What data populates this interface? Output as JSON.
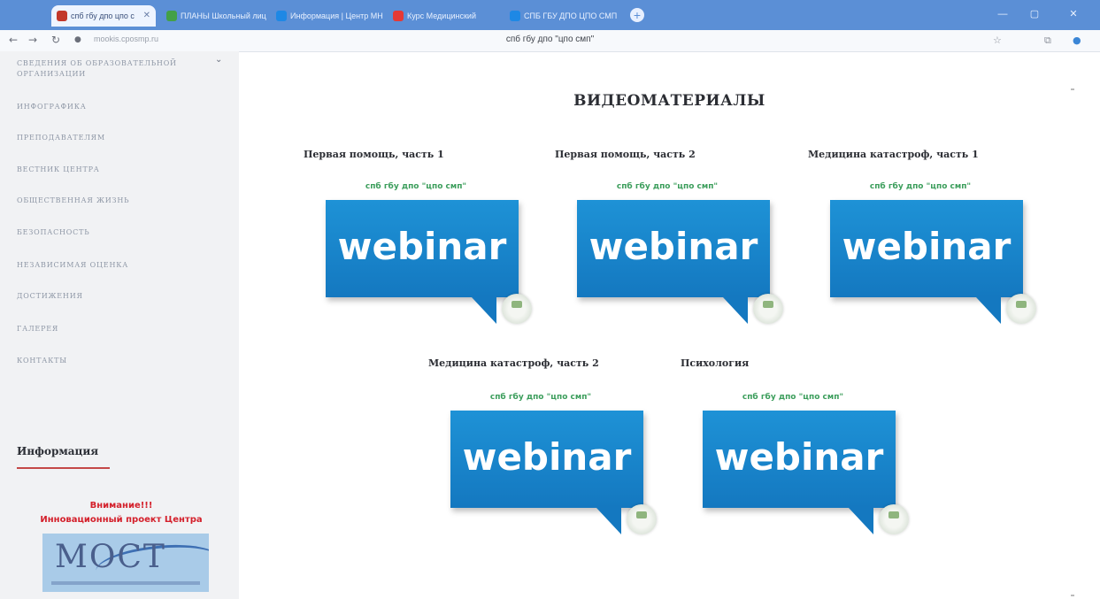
{
  "browser": {
    "tabs": [
      {
        "label": "спб гбу дпо цпо с",
        "active": true,
        "favicon_color": "#c2382b"
      },
      {
        "label": "ПЛАНЫ Школьный лиц",
        "active": false,
        "favicon_color": "#43a047"
      },
      {
        "label": "Информация | Центр МН",
        "active": false,
        "favicon_color": "#1e88e5"
      },
      {
        "label": "Курс Медицинский",
        "active": false,
        "favicon_color": "#e53935"
      },
      {
        "label": "СПБ ГБУ ДПО ЦПО СМП",
        "active": false,
        "favicon_color": "#1e88e5"
      }
    ],
    "new_tab": "+",
    "window_buttons": [
      "—",
      "▢",
      "✕"
    ],
    "url": "mookis.cposmp.ru",
    "page_title": "спб гбу дпо \"цпо смп\""
  },
  "sidebar": {
    "items": [
      {
        "label": "СВЕДЕНИЯ ОБ ОБРАЗОВАТЕЛЬНОЙ ОРГАНИЗАЦИИ"
      },
      {
        "label": "ИНФОГРАФИКА"
      },
      {
        "label": "ПРЕПОДАВАТЕЛЯМ"
      },
      {
        "label": "ВЕСТНИК ЦЕНТРА"
      },
      {
        "label": "ОБЩЕСТВЕННАЯ ЖИЗНЬ"
      },
      {
        "label": "БЕЗОПАСНОСТЬ"
      },
      {
        "label": "НЕЗАВИСИМАЯ ОЦЕНКА"
      },
      {
        "label": "ДОСТИЖЕНИЯ"
      },
      {
        "label": "ГАЛЕРЕЯ"
      },
      {
        "label": "КОНТАКТЫ"
      }
    ],
    "info_heading": "Информация",
    "notice_line1": "Внимание!!!",
    "notice_line2": "Инновационный проект Центра",
    "logo_text": "МОСТ"
  },
  "main": {
    "title": "ВИДЕОМАТЕРИАЛЫ",
    "videos": [
      {
        "title": "Первая помощь, часть 1",
        "caption": "спб гбу дпо \"цпо смп\"",
        "thumb_text": "webinar"
      },
      {
        "title": "Первая помощь, часть 2",
        "caption": "спб гбу дпо \"цпо смп\"",
        "thumb_text": "webinar"
      },
      {
        "title": "Медицина катастроф, часть 1",
        "caption": "спб гбу дпо \"цпо смп\"",
        "thumb_text": "webinar"
      },
      {
        "title": "Медицина катастроф, часть 2",
        "caption": "спб гбу дпо \"цпо смп\"",
        "thumb_text": "webinar"
      },
      {
        "title": "Психология",
        "caption": "спб гбу дпо \"цпо смп\"",
        "thumb_text": "webinar"
      }
    ]
  }
}
